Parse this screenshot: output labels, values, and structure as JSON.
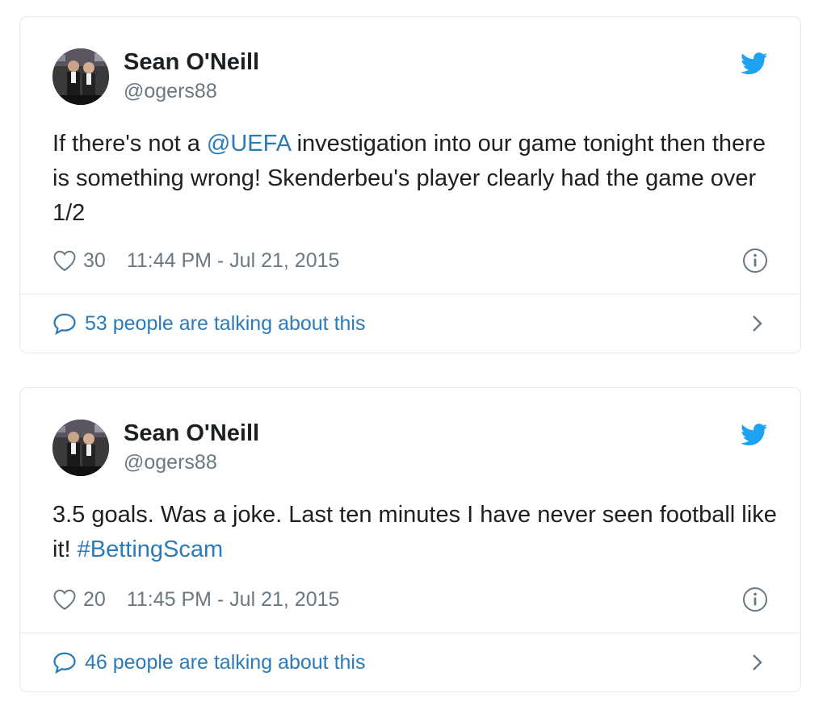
{
  "tweets": [
    {
      "author_name": "Sean O'Neill",
      "author_handle": "@ogers88",
      "text_pre": "If there's not a ",
      "text_mention": "@UEFA",
      "text_post": " investigation into our game tonight then there is something wrong! Skenderbeu's player clearly had the game over 1/2",
      "likes": "30",
      "timestamp": "11:44 PM - Jul 21, 2015",
      "talking": "53 people are talking about this"
    },
    {
      "author_name": "Sean O'Neill",
      "author_handle": "@ogers88",
      "text_pre": "3.5 goals. Was a joke. Last ten minutes I have never seen football like it! ",
      "text_hashtag": "#BettingScam",
      "likes": "20",
      "timestamp": "11:45 PM - Jul 21, 2015",
      "talking": "46 people are talking about this"
    }
  ],
  "icons": {
    "brand": "twitter-bird-icon",
    "like": "heart-icon",
    "info": "info-icon",
    "reply": "speech-bubble-icon",
    "more": "chevron-right-icon"
  },
  "colors": {
    "brand": "#1da1f2",
    "link": "#2b7bb9",
    "muted": "#697882",
    "text": "#1c2022",
    "border": "#e1e8ed"
  }
}
